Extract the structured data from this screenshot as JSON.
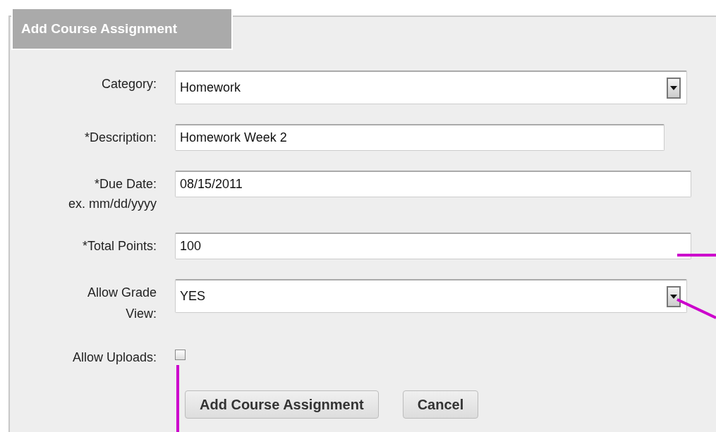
{
  "form": {
    "legend": "Add Course Assignment",
    "fields": [
      {
        "kind": "select",
        "label": "Category:",
        "value": "Homework"
      },
      {
        "kind": "text",
        "label": "*Description:",
        "value": "Homework Week 2"
      },
      {
        "kind": "text",
        "label": "*Due Date:",
        "hint": "ex. mm/dd/yyyy",
        "value": "08/15/2011"
      },
      {
        "kind": "text",
        "label": "*Total Points:",
        "value": "100"
      },
      {
        "kind": "select",
        "label": "Allow Grade\nView:",
        "value": "YES"
      },
      {
        "kind": "checkbox",
        "label": "Allow Uploads:",
        "checked": false
      }
    ],
    "buttons": [
      "Add Course Assignment",
      "Cancel"
    ]
  }
}
